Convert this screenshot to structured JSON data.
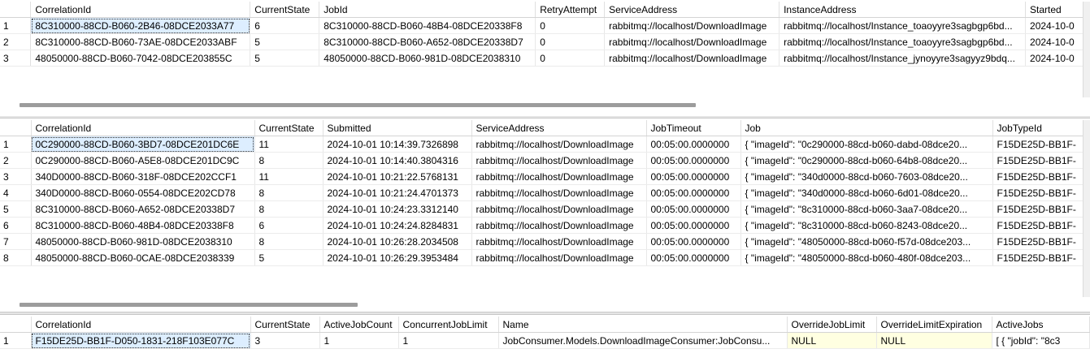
{
  "pane1": {
    "columns": [
      "",
      "CorrelationId",
      "CurrentState",
      "JobId",
      "RetryAttempt",
      "ServiceAddress",
      "InstanceAddress",
      "Started"
    ],
    "rows": [
      [
        "1",
        "8C310000-88CD-B060-2B46-08DCE2033A77",
        "6",
        "8C310000-88CD-B060-48B4-08DCE20338F8",
        "0",
        "rabbitmq://localhost/DownloadImage",
        "rabbitmq://localhost/Instance_toaoyyre3sagbgp6bd...",
        "2024-10-0"
      ],
      [
        "2",
        "8C310000-88CD-B060-73AE-08DCE2033ABF",
        "5",
        "8C310000-88CD-B060-A652-08DCE20338D7",
        "0",
        "rabbitmq://localhost/DownloadImage",
        "rabbitmq://localhost/Instance_toaoyyre3sagbgp6bd...",
        "2024-10-0"
      ],
      [
        "3",
        "48050000-88CD-B060-7042-08DCE203855C",
        "5",
        "48050000-88CD-B060-981D-08DCE2038310",
        "0",
        "rabbitmq://localhost/DownloadImage",
        "rabbitmq://localhost/Instance_jynoyyre3sagyyz9bdq...",
        "2024-10-0"
      ]
    ]
  },
  "pane2": {
    "columns": [
      "",
      "CorrelationId",
      "CurrentState",
      "Submitted",
      "ServiceAddress",
      "JobTimeout",
      "Job",
      "JobTypeId"
    ],
    "rows": [
      [
        "1",
        "0C290000-88CD-B060-3BD7-08DCE201DC6E",
        "11",
        "2024-10-01 10:14:39.7326898",
        "rabbitmq://localhost/DownloadImage",
        "00:05:00.0000000",
        "{   \"imageId\": \"0c290000-88cd-b060-dabd-08dce20...",
        "F15DE25D-BB1F-"
      ],
      [
        "2",
        "0C290000-88CD-B060-A5E8-08DCE201DC9C",
        "8",
        "2024-10-01 10:14:40.3804316",
        "rabbitmq://localhost/DownloadImage",
        "00:05:00.0000000",
        "{   \"imageId\": \"0c290000-88cd-b060-64b8-08dce20...",
        "F15DE25D-BB1F-"
      ],
      [
        "3",
        "340D0000-88CD-B060-318F-08DCE202CCF1",
        "11",
        "2024-10-01 10:21:22.5768131",
        "rabbitmq://localhost/DownloadImage",
        "00:05:00.0000000",
        "{   \"imageId\": \"340d0000-88cd-b060-7603-08dce20...",
        "F15DE25D-BB1F-"
      ],
      [
        "4",
        "340D0000-88CD-B060-0554-08DCE202CD78",
        "8",
        "2024-10-01 10:21:24.4701373",
        "rabbitmq://localhost/DownloadImage",
        "00:05:00.0000000",
        "{   \"imageId\": \"340d0000-88cd-b060-6d01-08dce20...",
        "F15DE25D-BB1F-"
      ],
      [
        "5",
        "8C310000-88CD-B060-A652-08DCE20338D7",
        "8",
        "2024-10-01 10:24:23.3312140",
        "rabbitmq://localhost/DownloadImage",
        "00:05:00.0000000",
        "{   \"imageId\": \"8c310000-88cd-b060-3aa7-08dce20...",
        "F15DE25D-BB1F-"
      ],
      [
        "6",
        "8C310000-88CD-B060-48B4-08DCE20338F8",
        "6",
        "2024-10-01 10:24:24.8284831",
        "rabbitmq://localhost/DownloadImage",
        "00:05:00.0000000",
        "{   \"imageId\": \"8c310000-88cd-b060-8243-08dce20...",
        "F15DE25D-BB1F-"
      ],
      [
        "7",
        "48050000-88CD-B060-981D-08DCE2038310",
        "8",
        "2024-10-01 10:26:28.2034508",
        "rabbitmq://localhost/DownloadImage",
        "00:05:00.0000000",
        "{   \"imageId\": \"48050000-88cd-b060-f57d-08dce203...",
        "F15DE25D-BB1F-"
      ],
      [
        "8",
        "48050000-88CD-B060-0CAE-08DCE2038339",
        "5",
        "2024-10-01 10:26:29.3953484",
        "rabbitmq://localhost/DownloadImage",
        "00:05:00.0000000",
        "{   \"imageId\": \"48050000-88cd-b060-480f-08dce203...",
        "F15DE25D-BB1F-"
      ]
    ]
  },
  "pane3": {
    "columns": [
      "",
      "CorrelationId",
      "CurrentState",
      "ActiveJobCount",
      "ConcurrentJobLimit",
      "Name",
      "OverrideJobLimit",
      "OverrideLimitExpiration",
      "ActiveJobs"
    ],
    "rows": [
      [
        "1",
        "F15DE25D-BB1F-D050-1831-218F103E077C",
        "3",
        "1",
        "1",
        "JobConsumer.Models.DownloadImageConsumer:JobConsu...",
        "NULL",
        "NULL",
        "[   {     \"jobId\": \"8c3"
      ]
    ]
  },
  "colors": {
    "null_cell": "#ffffe1",
    "selected_cell": "#ddeeff",
    "scroll_thumb": "#9c9c9c"
  }
}
